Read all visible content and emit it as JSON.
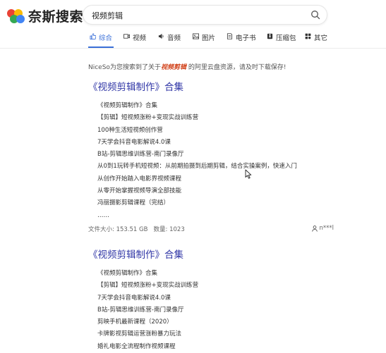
{
  "brand": {
    "name": "奈斯搜索"
  },
  "search": {
    "value": "视频剪辑",
    "icon": "search-icon"
  },
  "tabs": [
    {
      "label": "综合",
      "icon": "like-icon",
      "active": true
    },
    {
      "label": "视频",
      "icon": "video-icon"
    },
    {
      "label": "音频",
      "icon": "audio-icon"
    },
    {
      "label": "图片",
      "icon": "image-icon"
    },
    {
      "label": "电子书",
      "icon": "book-icon"
    },
    {
      "label": "压缩包",
      "icon": "archive-icon"
    },
    {
      "label": "其它",
      "icon": "other-icon"
    }
  ],
  "notice": {
    "prefix": "NiceSo为您搜索到了关于",
    "keyword": "视频剪辑",
    "suffix": "的阿里云盘资源，请及时下载保存!"
  },
  "results": [
    {
      "title": "《视频剪辑制作》合集",
      "items": [
        "《视频剪辑制作》合集",
        "【剪辑】短视频涨粉+变现实战训练营",
        "100种生活短视频创作营",
        "7天学会抖音电影解说4.0课",
        "B站-剪辑思维训练营-南门录像厅",
        "从0到1玩转手机短视频：从前期拍摄到后期剪辑，结合实操案例，快速入门",
        "从创作开始踏入电影界视频课程",
        "从零开始掌握视频导演全部技能",
        "冯丽摄影剪辑课程（完结）",
        "……"
      ],
      "file_size_label": "文件大小: 153.51 GB",
      "count_label": "数量: 1023",
      "owner": "n***l"
    },
    {
      "title": "《视频剪辑制作》合集",
      "items": [
        "《视频剪辑制作》合集",
        "【剪辑】短视频涨粉+变现实战训练营",
        "7天学会抖音电影解说4.0课",
        "B站-剪辑思维训练营-南门录像厅",
        "剪映手机最新课程（2020）",
        "卡牌影视剪辑运营涨粉暴力玩法",
        "婚礼电影全流程制作视频课程"
      ]
    }
  ],
  "colors": {
    "accent": "#3a6fd8",
    "title": "#3036a6",
    "keyword": "#d2451e"
  }
}
